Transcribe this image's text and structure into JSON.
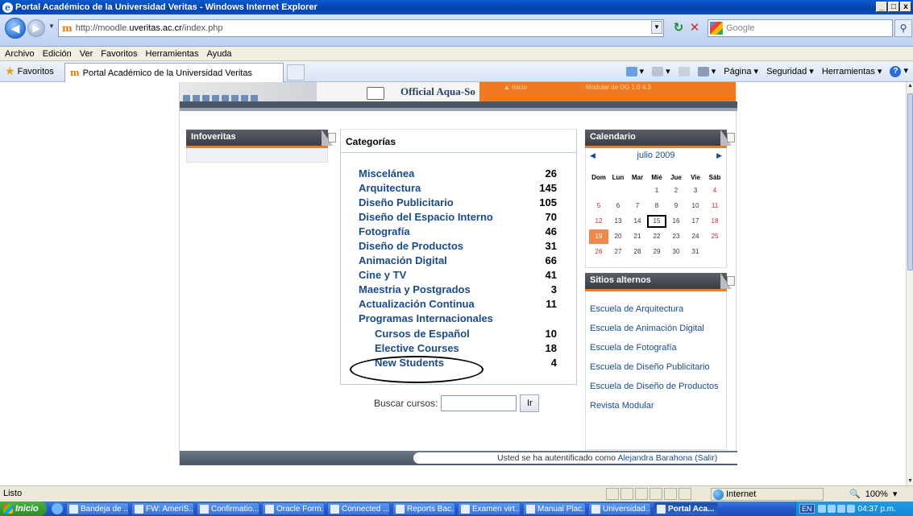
{
  "window": {
    "title": "Portal Académico de la Universidad Veritas - Windows Internet Explorer",
    "controls": [
      "_",
      "□",
      "x"
    ]
  },
  "address": {
    "url_prefix": "http://moodle.",
    "url_domain": "uveritas.ac.cr",
    "url_suffix": "/index.php",
    "search_placeholder": "Google"
  },
  "menu": [
    "Archivo",
    "Edición",
    "Ver",
    "Favoritos",
    "Herramientas",
    "Ayuda"
  ],
  "favbar": {
    "favorites_label": "Favoritos",
    "tab_title": "Portal Académico de la Universidad Veritas",
    "commands": [
      "Página",
      "Seguridad",
      "Herramientas"
    ]
  },
  "header": {
    "official_text": "Official Aqua-So",
    "orange_text_1": "▲ Inicio",
    "orange_text_2": "Modular de DG 1.0 4.3"
  },
  "infoveritas": {
    "title": "Infoveritas"
  },
  "categorias": {
    "title": "Categorías",
    "items": [
      {
        "name": "Miscelánea",
        "count": "26",
        "sub": false
      },
      {
        "name": "Arquitectura",
        "count": "145",
        "sub": false
      },
      {
        "name": "Diseño Publicitario",
        "count": "105",
        "sub": false
      },
      {
        "name": "Diseño del Espacio Interno",
        "count": "70",
        "sub": false
      },
      {
        "name": "Fotografía",
        "count": "46",
        "sub": false
      },
      {
        "name": "Diseño de Productos",
        "count": "31",
        "sub": false
      },
      {
        "name": "Animación Digital",
        "count": "66",
        "sub": false
      },
      {
        "name": "Cine y TV",
        "count": "41",
        "sub": false
      },
      {
        "name": "Maestria y Postgrados",
        "count": "3",
        "sub": false
      },
      {
        "name": "Actualización Continua",
        "count": "11",
        "sub": false
      },
      {
        "name": "Programas Internacionales",
        "count": "",
        "sub": false
      },
      {
        "name": "Cursos de Español",
        "count": "10",
        "sub": true
      },
      {
        "name": "Elective Courses",
        "count": "18",
        "sub": true
      },
      {
        "name": "New Students",
        "count": "4",
        "sub": true
      }
    ]
  },
  "search_cursos": {
    "label": "Buscar cursos:",
    "button": "Ir"
  },
  "calendario": {
    "title": "Calendario",
    "month": "julio 2009",
    "weekdays": [
      "Dom",
      "Lun",
      "Mar",
      "Mié",
      "Jue",
      "Vie",
      "Sáb"
    ],
    "weeks": [
      [
        "",
        "",
        "",
        "1",
        "2",
        "3",
        "4"
      ],
      [
        "5",
        "6",
        "7",
        "8",
        "9",
        "10",
        "11"
      ],
      [
        "12",
        "13",
        "14",
        "15",
        "16",
        "17",
        "18"
      ],
      [
        "19",
        "20",
        "21",
        "22",
        "23",
        "24",
        "25"
      ],
      [
        "26",
        "27",
        "28",
        "29",
        "30",
        "31",
        ""
      ]
    ],
    "today": "15",
    "event_day": "19"
  },
  "sitios": {
    "title": "Sitios alternos",
    "links": [
      "Escuela de Arquitectura",
      "Escuela de Animación Digital",
      "Escuela de Fotografía",
      "Escuela de Diseño Publicitario",
      "Escuela de Diseño de Productos",
      "Revista Modular"
    ]
  },
  "footer": {
    "prefix": "Usted se ha autentificado como ",
    "user": "Alejandra Barahona",
    "logout": "(Salir)"
  },
  "statusbar": {
    "status": "Listo",
    "zone": "Internet",
    "zoom": "100%"
  },
  "taskbar": {
    "start": "Inicio",
    "buttons": [
      "Bandeja de ...",
      "FW: AmeriS...",
      "Confirmatio...",
      "Oracle Form...",
      "Connected ...",
      "Reports Bac...",
      "Examen virt...",
      "Manual Plac...",
      "Universidad...",
      "Portal Aca..."
    ],
    "active_index": 9,
    "language": "EN",
    "clock": "04:37 p.m."
  }
}
